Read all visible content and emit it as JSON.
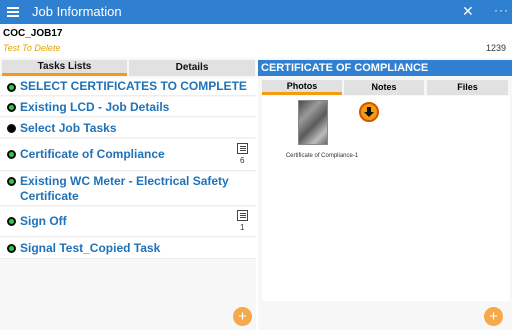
{
  "window": {
    "title": "Job Information",
    "close_glyph": "✕",
    "more_glyph": "···"
  },
  "job": {
    "id": "COC_JOB17",
    "subtitle": "Test To Delete",
    "number": "1239"
  },
  "left_tabs": [
    {
      "label": "Tasks Lists",
      "active": true
    },
    {
      "label": "Details",
      "active": false
    }
  ],
  "tasks": [
    {
      "label": "SELECT CERTIFICATES TO COMPLETE",
      "status": "green"
    },
    {
      "label": "Existing LCD - Job Details",
      "status": "green"
    },
    {
      "label": "Select Job Tasks",
      "status": "black"
    },
    {
      "label": "Certificate of Compliance",
      "status": "green",
      "notes": "6"
    },
    {
      "label": "Existing WC Meter - Electrical Safety",
      "label2": "Certificate",
      "status": "green"
    },
    {
      "label": "Sign Off",
      "status": "green",
      "notes": "1"
    },
    {
      "label": "Signal Test_Copied Task",
      "status": "green"
    }
  ],
  "right_panel": {
    "header": "CERTIFICATE OF COMPLIANCE",
    "tabs": [
      {
        "label": "Photos",
        "active": true
      },
      {
        "label": "Notes",
        "active": false
      },
      {
        "label": "Files",
        "active": false
      }
    ],
    "photo_caption": "Certificate of Compliance-1"
  },
  "fab_glyph": "+",
  "colors": {
    "accent": "#2f80d1",
    "tab_active_underline": "#f39c12",
    "task_text": "#1f72b8",
    "status_green": "#2ecc40",
    "fab": "#f5a94a",
    "subtitle": "#e0a400"
  }
}
